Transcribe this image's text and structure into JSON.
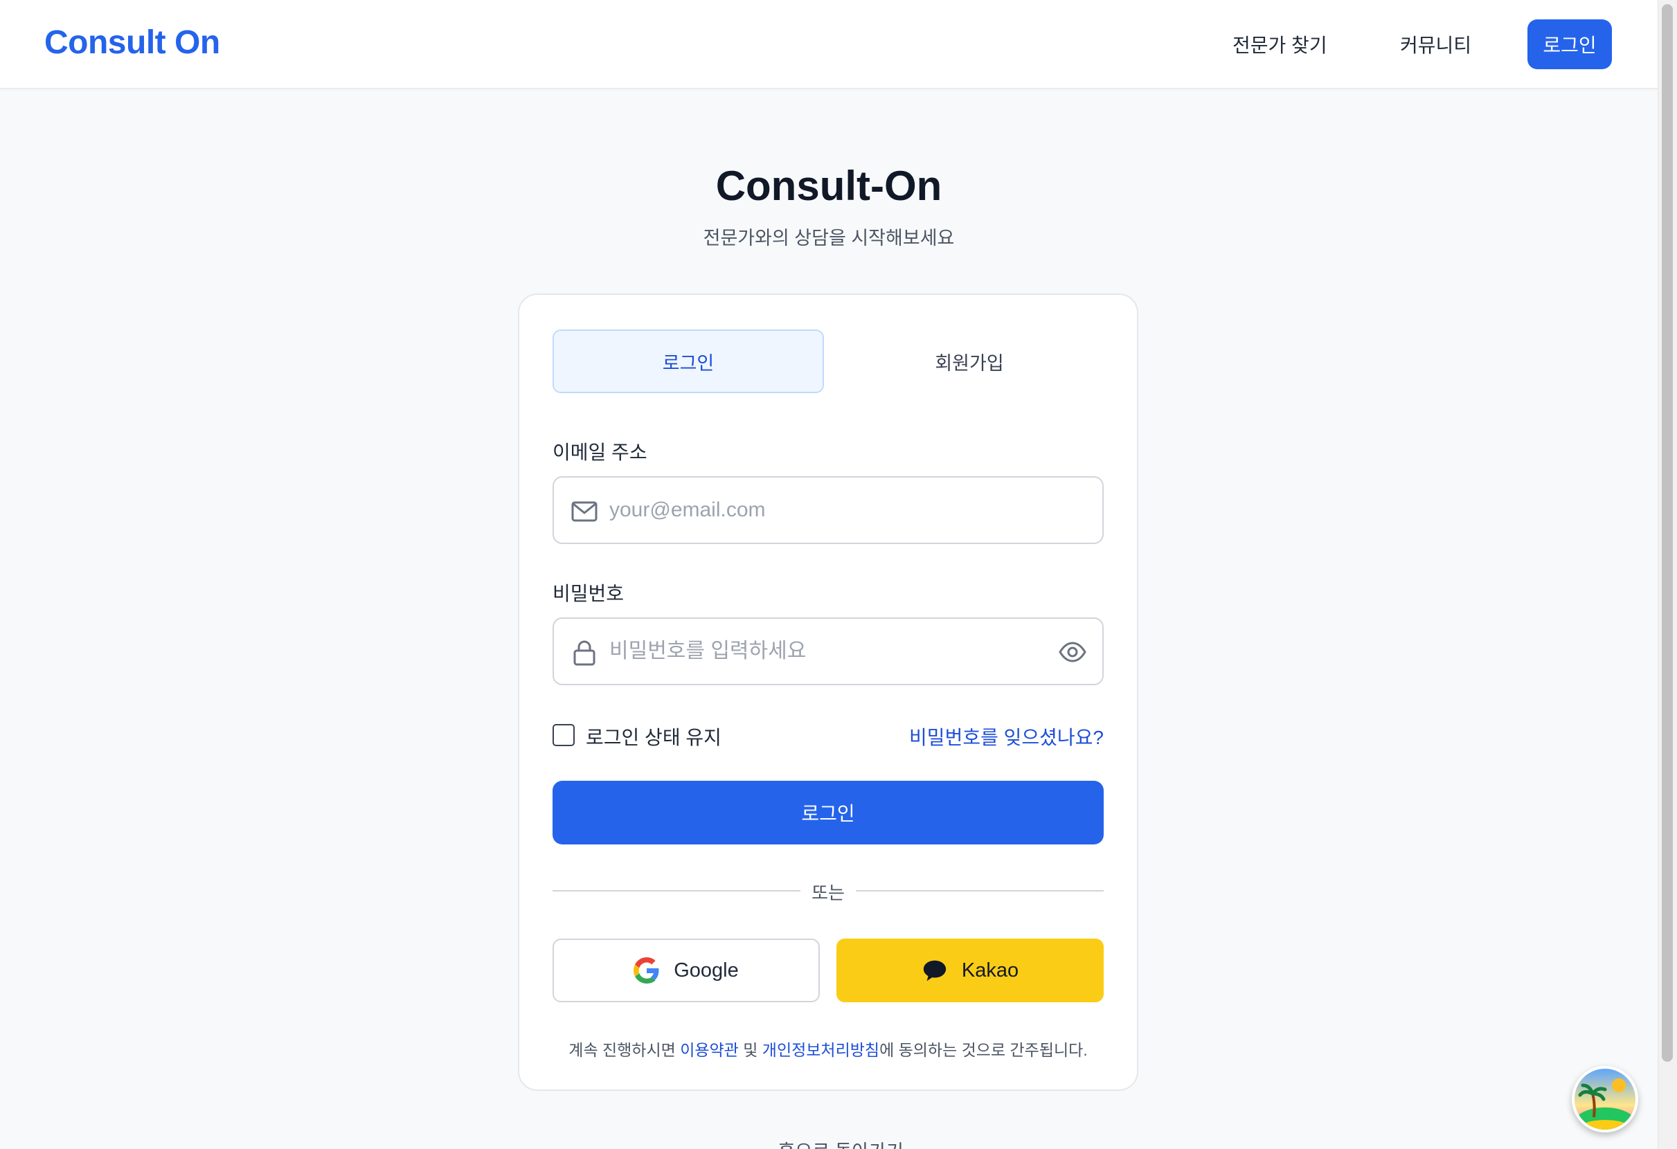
{
  "header": {
    "logo": "Consult On",
    "nav": {
      "find_experts": "전문가 찾기",
      "community": "커뮤니티",
      "login": "로그인"
    }
  },
  "hero": {
    "title": "Consult-On",
    "subtitle": "전문가와의 상담을 시작해보세요"
  },
  "auth_card": {
    "tabs": {
      "login": "로그인",
      "signup": "회원가입"
    },
    "email": {
      "label": "이메일 주소",
      "placeholder": "your@email.com",
      "value": ""
    },
    "password": {
      "label": "비밀번호",
      "placeholder": "비밀번호를 입력하세요",
      "value": ""
    },
    "remember_me": {
      "label": "로그인 상태 유지",
      "checked": false
    },
    "forgot_password": "비밀번호를 잊으셨나요?",
    "submit": "로그인",
    "divider": "또는",
    "social": {
      "google": "Google",
      "kakao": "Kakao"
    },
    "terms": {
      "prefix": "계속 진행하시면 ",
      "terms_link": "이용약관",
      "conjunction": " 및 ",
      "privacy_link": "개인정보처리방침",
      "suffix": "에 동의하는 것으로 간주됩니다."
    }
  },
  "footer": {
    "back_home": "← 홈으로 돌아가기"
  },
  "colors": {
    "brand": "#2563eb",
    "link": "#1d4ed8",
    "kakao": "#facc15",
    "background": "#f8f9fb"
  },
  "icons": {
    "email": "mail-icon",
    "password": "lock-icon",
    "toggle_visibility": "eye-icon",
    "google": "google-logo-icon",
    "kakao": "kakao-chat-bubble-icon"
  }
}
